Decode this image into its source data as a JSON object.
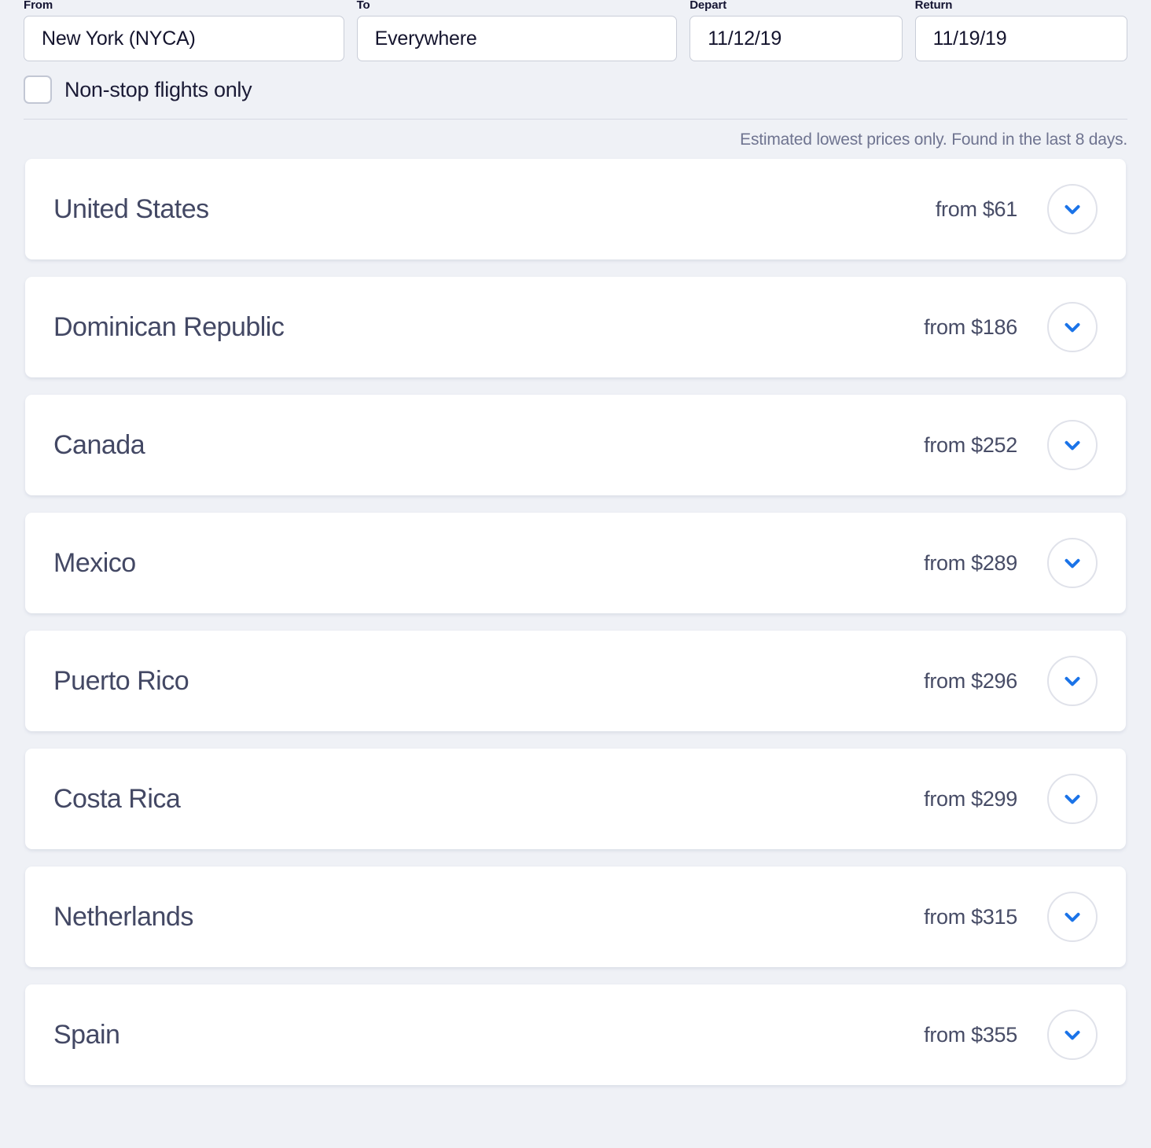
{
  "search": {
    "from": {
      "label": "From",
      "value": "New York (NYCA)"
    },
    "to": {
      "label": "To",
      "value": "Everywhere"
    },
    "depart": {
      "label": "Depart",
      "value": "11/12/19"
    },
    "return": {
      "label": "Return",
      "value": "11/19/19"
    },
    "nonstop": {
      "label": "Non-stop flights only",
      "checked": false
    }
  },
  "disclaimer": "Estimated lowest prices only. Found in the last 8 days.",
  "results": [
    {
      "country": "United States",
      "price": "from $61"
    },
    {
      "country": "Dominican Republic",
      "price": "from $186"
    },
    {
      "country": "Canada",
      "price": "from $252"
    },
    {
      "country": "Mexico",
      "price": "from $289"
    },
    {
      "country": "Puerto Rico",
      "price": "from $296"
    },
    {
      "country": "Costa Rica",
      "price": "from $299"
    },
    {
      "country": "Netherlands",
      "price": "from $315"
    },
    {
      "country": "Spain",
      "price": "from $355"
    }
  ],
  "icons": {
    "expand": "chevron-down-icon"
  },
  "colors": {
    "accent": "#1a73e8",
    "background": "#eff1f6",
    "card": "#ffffff",
    "text": "#434864",
    "muted": "#6f7490"
  }
}
